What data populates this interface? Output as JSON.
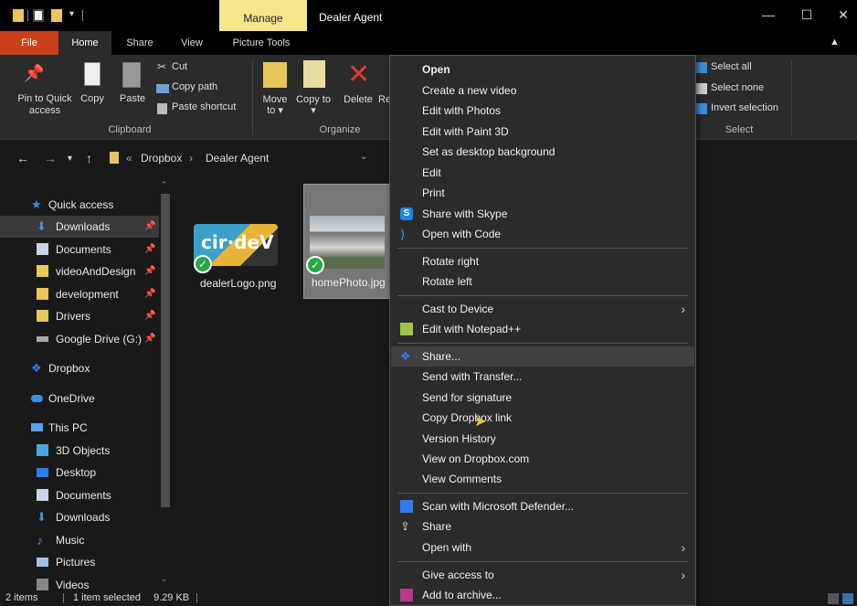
{
  "window": {
    "title": "Dealer Agent",
    "manage_tab": "Manage"
  },
  "ribbon_tabs": [
    "File",
    "Home",
    "Share",
    "View",
    "Picture Tools"
  ],
  "ribbon": {
    "pin_label": "Pin to Quick access",
    "copy_label": "Copy",
    "paste_label": "Paste",
    "cut_label": "Cut",
    "copy_path_label": "Copy path",
    "paste_shortcut_label": "Paste shortcut",
    "clipboard_group": "Clipboard",
    "move_to_label": "Move to",
    "copy_to_label": "Copy to",
    "delete_label": "Delete",
    "rename_label": "Re",
    "organize_group": "Organize",
    "select_all_label": "Select all",
    "select_none_label": "Select none",
    "invert_selection_label": "Invert selection",
    "select_group": "Select"
  },
  "address": {
    "prefix": "«",
    "crumbs": [
      "Dropbox",
      "Dealer Agent"
    ]
  },
  "nav": [
    {
      "label": "Quick access",
      "pinned": false
    },
    {
      "label": "Downloads",
      "pinned": true
    },
    {
      "label": "Documents",
      "pinned": true
    },
    {
      "label": "videoAndDesign",
      "pinned": true
    },
    {
      "label": "development",
      "pinned": true
    },
    {
      "label": "Drivers",
      "pinned": true
    },
    {
      "label": "Google Drive (G:)",
      "pinned": true
    },
    {
      "label": "Dropbox",
      "pinned": false
    },
    {
      "label": "OneDrive",
      "pinned": false
    },
    {
      "label": "This PC",
      "pinned": false
    },
    {
      "label": "3D Objects",
      "pinned": false
    },
    {
      "label": "Desktop",
      "pinned": false
    },
    {
      "label": "Documents",
      "pinned": false
    },
    {
      "label": "Downloads",
      "pinned": false
    },
    {
      "label": "Music",
      "pinned": false
    },
    {
      "label": "Pictures",
      "pinned": false
    },
    {
      "label": "Videos",
      "pinned": false
    }
  ],
  "files": [
    {
      "name": "dealerLogo.png",
      "logo_text": "cir·deV"
    },
    {
      "name": "homePhoto.jpg"
    }
  ],
  "status": {
    "items": "2 items",
    "selected": "1 item selected",
    "size": "9.29 KB"
  },
  "context_menu": [
    "Open",
    "Create a new video",
    "Edit with Photos",
    "Edit with Paint 3D",
    "Set as desktop background",
    "Edit",
    "Print",
    "Share with Skype",
    "Open with Code",
    "Rotate right",
    "Rotate left",
    "Cast to Device",
    "Edit with Notepad++",
    "Share...",
    "Send with Transfer...",
    "Send for signature",
    "Copy Dropbox link",
    "Version History",
    "View on Dropbox.com",
    "View Comments",
    "Scan with Microsoft Defender...",
    "Share",
    "Open with",
    "Give access to",
    "Add to archive..."
  ],
  "colors": {
    "file_tab": "#c9401b",
    "manage_tab": "#f6e58d",
    "check": "#27a745",
    "dropbox": "#2f7cf6"
  }
}
